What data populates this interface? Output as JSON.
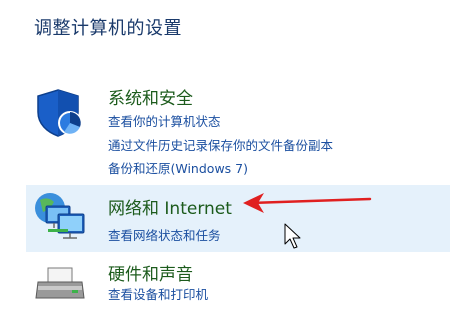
{
  "page": {
    "title": "调整计算机的设置"
  },
  "categories": [
    {
      "heading": "系统和安全",
      "icon": "shield-icon",
      "links": [
        "查看你的计算机状态",
        "通过文件历史记录保存你的文件备份副本",
        "备份和还原(Windows 7)"
      ]
    },
    {
      "heading": "网络和 Internet",
      "icon": "network-icon",
      "highlighted": true,
      "links": [
        "查看网络状态和任务"
      ]
    },
    {
      "heading": "硬件和声音",
      "icon": "printer-icon",
      "links": [
        "查看设备和打印机"
      ]
    }
  ],
  "colors": {
    "heading": "#1c5b1c",
    "link": "#1b4fa0",
    "highlight": "#e5f1fb",
    "annotation_arrow": "#e02020"
  },
  "annotation": {
    "type": "arrow",
    "color": "#e02020"
  },
  "cursor": {
    "icon": "mouse-pointer-icon"
  }
}
